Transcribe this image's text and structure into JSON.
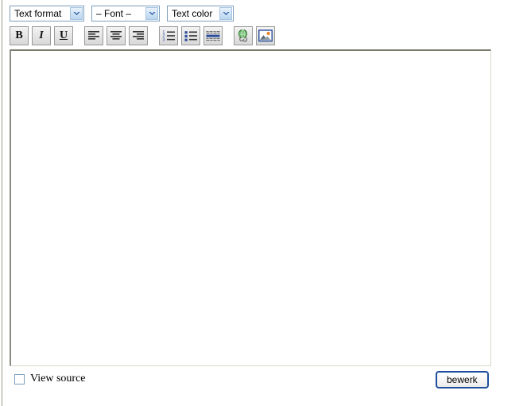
{
  "page": {
    "background_color": "#ffffff",
    "left_rule_color": "#9a9a8e"
  },
  "toolbar": {
    "selects": [
      {
        "name": "text-format",
        "value": "Text format",
        "arrow_icon": "chevron-down-icon"
      },
      {
        "name": "font",
        "value": "– Font –",
        "arrow_icon": "chevron-down-icon"
      },
      {
        "name": "text-color",
        "value": "Text color",
        "arrow_icon": "chevron-down-icon"
      }
    ],
    "buttons": {
      "bold": {
        "label": "B",
        "icon": "bold-icon",
        "title": "Bold"
      },
      "italic": {
        "label": "I",
        "icon": "italic-icon",
        "title": "Italic"
      },
      "underline": {
        "label": "U",
        "icon": "underline-icon",
        "title": "Underline"
      },
      "align_left": {
        "icon": "align-left-icon",
        "title": "Align left"
      },
      "align_center": {
        "icon": "align-center-icon",
        "title": "Align center"
      },
      "align_right": {
        "icon": "align-right-icon",
        "title": "Align right"
      },
      "ordered_list": {
        "icon": "ordered-list-icon",
        "title": "Numbered list"
      },
      "unordered_list": {
        "icon": "unordered-list-icon",
        "title": "Bulleted list"
      },
      "horizontal_rule": {
        "icon": "horizontal-rule-icon",
        "title": "Horizontal rule"
      },
      "insert_link": {
        "icon": "globe-link-icon",
        "title": "Insert link"
      },
      "insert_image": {
        "icon": "image-icon",
        "title": "Insert image"
      }
    }
  },
  "editor": {
    "content": "",
    "placeholder": ""
  },
  "footer": {
    "view_source": {
      "label": "View source",
      "checked": false
    },
    "submit_button": {
      "label": "bewerk"
    }
  },
  "colors": {
    "select_border": "#7b9ebd",
    "button_border": "#9a9a9a",
    "canvas_border": "#7a7a6e",
    "submit_border": "#1f4e9c",
    "list_marker_blue": "#2b4c9b"
  }
}
